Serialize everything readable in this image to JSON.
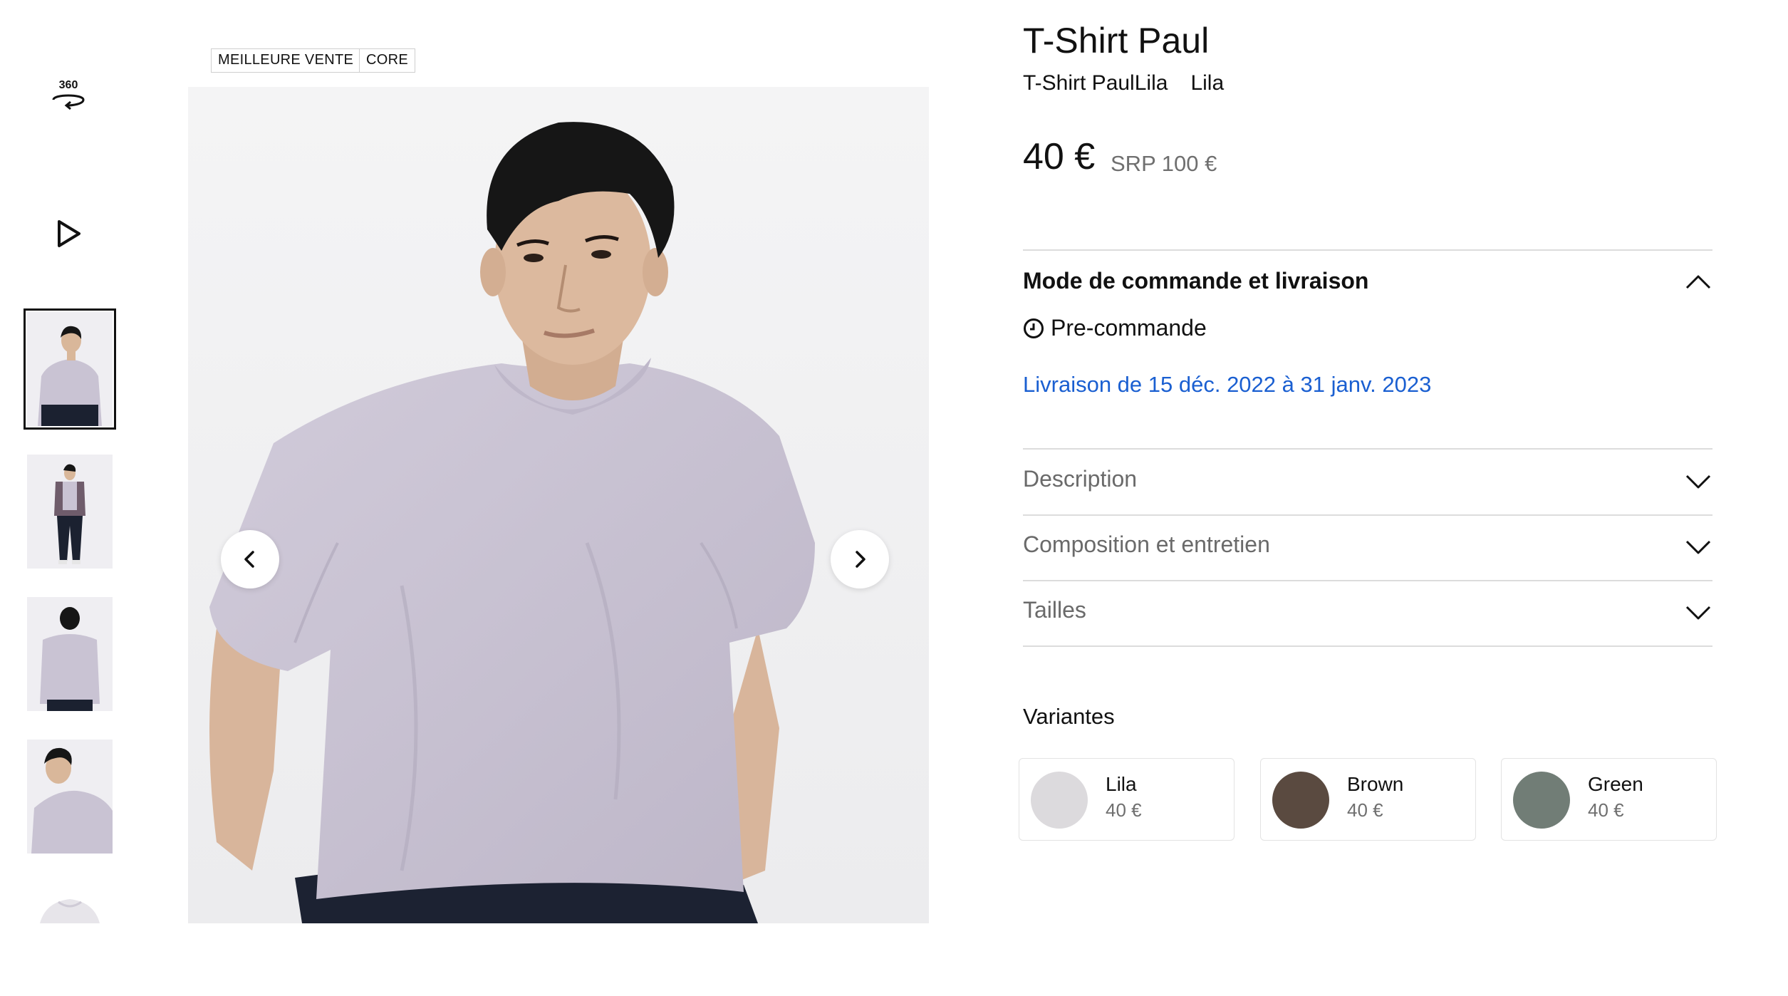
{
  "badges": [
    "MEILLEURE VENTE",
    "CORE"
  ],
  "rail": {
    "view360_label": "360",
    "icons": [
      "rotate-360-icon",
      "play-icon"
    ]
  },
  "product": {
    "title": "T-Shirt Paul",
    "subtitle_name": "T-Shirt PaulLila",
    "subtitle_color": "Lila",
    "price": "40 €",
    "srp": "SRP 100 €"
  },
  "ordering": {
    "title": "Mode de commande et livraison",
    "mode": "Pre-commande",
    "delivery": "Livraison de 15 déc. 2022 à 31 janv. 2023"
  },
  "accordions": [
    "Description",
    "Composition et entretien",
    "Tailles"
  ],
  "variants": {
    "label": "Variantes",
    "items": [
      {
        "name": "Lila",
        "price": "40 €",
        "color": "#dcdadd"
      },
      {
        "name": "Brown",
        "price": "40 €",
        "color": "#5a4a40"
      },
      {
        "name": "Green",
        "price": "40 €",
        "color": "#717d76"
      }
    ]
  },
  "colors": {
    "accent_link": "#1a5fd1",
    "tshirt": "#c9c3d3",
    "hair": "#161616"
  }
}
